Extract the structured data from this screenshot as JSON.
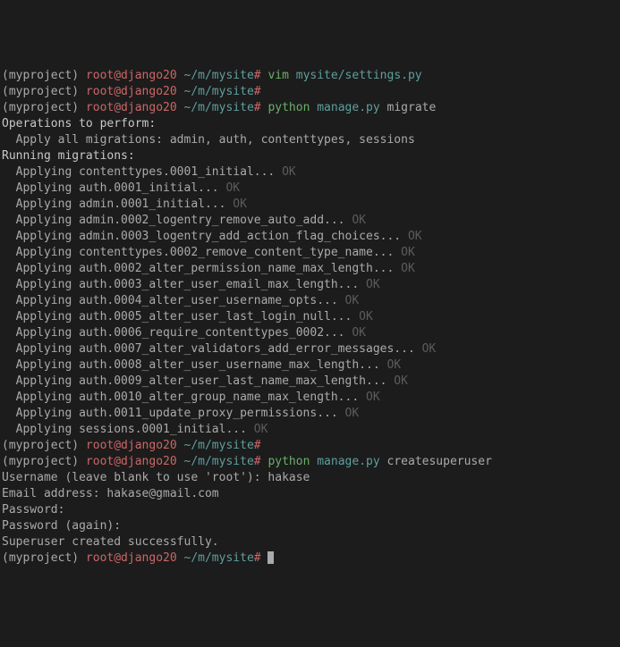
{
  "prompt": {
    "env": "(myproject) ",
    "user": "root@django20",
    "sep": " ",
    "path": "~/m/mysite",
    "sharp": "#",
    "space": " "
  },
  "commands": {
    "vim": {
      "cmd": "vim",
      "arg": "mysite/settings.py"
    },
    "migrate": {
      "cmd": "python",
      "arg": "manage.py",
      "rest": "migrate"
    },
    "createsu": {
      "cmd": "python",
      "arg": "manage.py",
      "rest": "createsuperuser"
    }
  },
  "migration": {
    "header1": "Operations to perform:",
    "apply_all": "  Apply all migrations: admin, auth, contenttypes, sessions",
    "header2": "Running migrations:",
    "items": [
      "  Applying contenttypes.0001_initial...",
      "  Applying auth.0001_initial...",
      "  Applying admin.0001_initial...",
      "  Applying admin.0002_logentry_remove_auto_add...",
      "  Applying admin.0003_logentry_add_action_flag_choices...",
      "  Applying contenttypes.0002_remove_content_type_name...",
      "  Applying auth.0002_alter_permission_name_max_length...",
      "  Applying auth.0003_alter_user_email_max_length...",
      "  Applying auth.0004_alter_user_username_opts...",
      "  Applying auth.0005_alter_user_last_login_null...",
      "  Applying auth.0006_require_contenttypes_0002...",
      "  Applying auth.0007_alter_validators_add_error_messages...",
      "  Applying auth.0008_alter_user_username_max_length...",
      "  Applying auth.0009_alter_user_last_name_max_length...",
      "  Applying auth.0010_alter_group_name_max_length...",
      "  Applying auth.0011_update_proxy_permissions...",
      "  Applying sessions.0001_initial..."
    ],
    "ok": " OK"
  },
  "superuser": {
    "username_prompt": "Username (leave blank to use 'root'): hakase",
    "email_prompt": "Email address: hakase@gmail.com",
    "password_prompt": "Password:",
    "password_again": "Password (again):",
    "success": "Superuser created successfully."
  }
}
